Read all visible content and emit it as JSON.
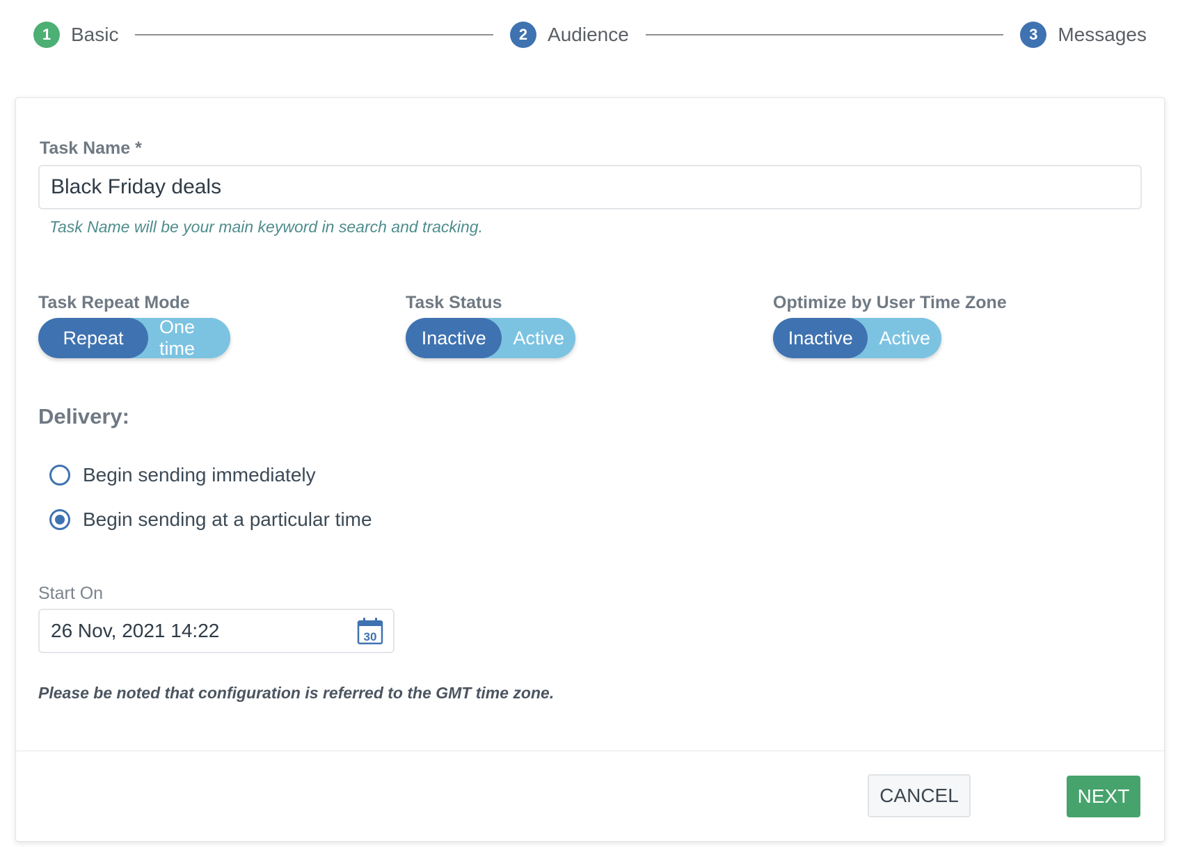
{
  "stepper": {
    "steps": [
      {
        "number": "1",
        "label": "Basic",
        "color": "#4caf74"
      },
      {
        "number": "2",
        "label": "Audience",
        "color": "#3f72b0"
      },
      {
        "number": "3",
        "label": "Messages",
        "color": "#3f72b0"
      }
    ]
  },
  "form": {
    "task_name": {
      "label": "Task Name *",
      "value": "Black Friday deals",
      "hint": "Task Name will be your main keyword in search and tracking."
    },
    "repeat_mode": {
      "label": "Task Repeat Mode",
      "options": [
        "Repeat",
        "One time"
      ],
      "selected": "Repeat"
    },
    "task_status": {
      "label": "Task Status",
      "options": [
        "Inactive",
        "Active"
      ],
      "selected": "Inactive"
    },
    "optimize_tz": {
      "label": "Optimize by User Time Zone",
      "options": [
        "Inactive",
        "Active"
      ],
      "selected": "Inactive"
    },
    "delivery": {
      "title": "Delivery:",
      "options": [
        {
          "label": "Begin sending immediately",
          "checked": false
        },
        {
          "label": "Begin sending at a particular time",
          "checked": true
        }
      ]
    },
    "start_on": {
      "label": "Start On",
      "value": "26 Nov, 2021 14:22",
      "calendar_day": "30",
      "icon": "calendar-icon"
    },
    "note": "Please be noted that configuration is referred to the GMT time zone."
  },
  "footer": {
    "cancel_label": "CANCEL",
    "next_label": "NEXT"
  },
  "colors": {
    "primary": "#3f72b0",
    "toggle_light": "#7cc3e2",
    "success": "#46a36c"
  }
}
